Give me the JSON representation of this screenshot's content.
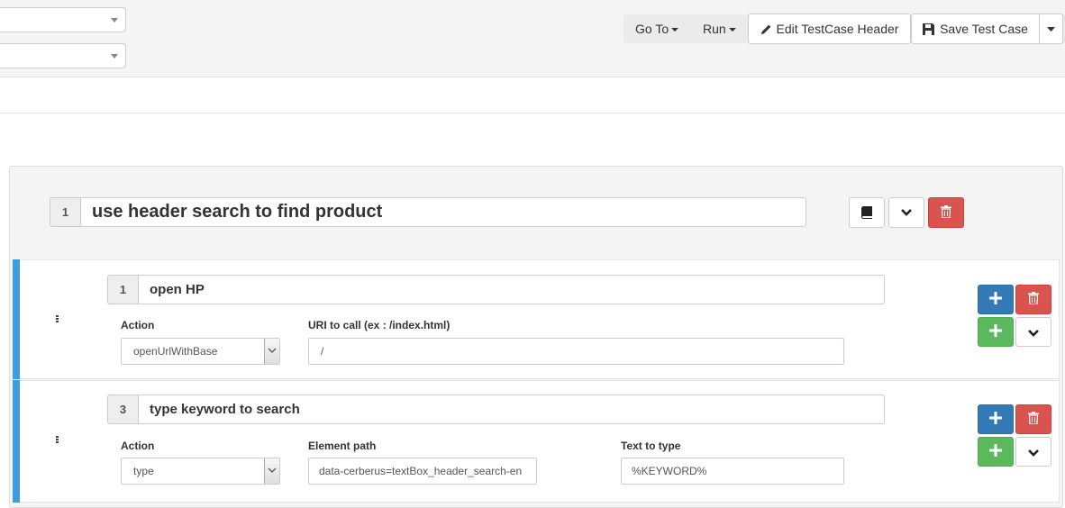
{
  "toolbar": {
    "goto_label": "Go To",
    "run_label": "Run",
    "edit_header_label": "Edit TestCase Header",
    "save_label": "Save Test Case"
  },
  "steps": [
    {
      "number": "1",
      "description": "use header search to find product",
      "actions": [
        {
          "number": "1",
          "description": "open HP",
          "action_label": "Action",
          "action_value": "openUrlWithBase",
          "param1_label": "URI to call (ex : /index.html)",
          "param1_value": "/"
        },
        {
          "number": "3",
          "description": "type keyword to search",
          "action_label": "Action",
          "action_value": "type",
          "param1_label": "Element path",
          "param1_value": "data-cerberus=textBox_header_search-en",
          "param2_label": "Text to type",
          "param2_value": "%KEYWORD%"
        }
      ]
    }
  ],
  "colors": {
    "primary": "#337ab7",
    "danger": "#d9534f",
    "success": "#5cb85c",
    "step_accent": "#3d9ee2"
  }
}
